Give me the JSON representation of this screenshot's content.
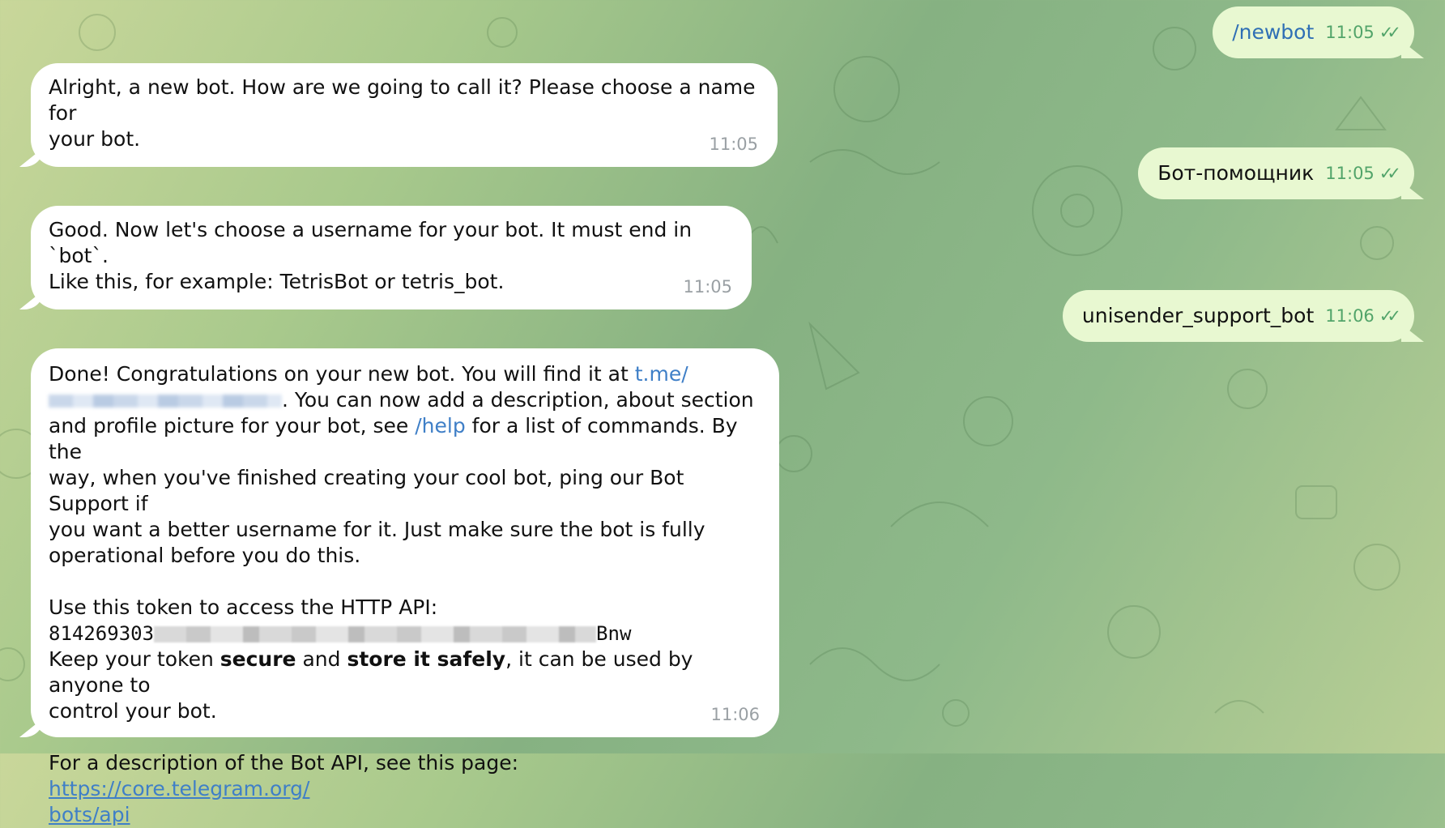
{
  "messages": {
    "out1": {
      "text": "/newbot",
      "time": "11:05"
    },
    "in1": {
      "line1": "Alright, a new bot. How are we going to call it? Please choose a name for",
      "line2": "your bot.",
      "time": "11:05"
    },
    "out2": {
      "text": "Бот-помощник",
      "time": "11:05"
    },
    "in2": {
      "line1": "Good. Now let's choose a username for your bot. It must end in `bot`.",
      "line2": "Like this, for example: TetrisBot or tetris_bot.",
      "time": "11:05"
    },
    "out3": {
      "text": "unisender_support_bot",
      "time": "11:06"
    },
    "in3": {
      "p1_a": "Done! Congratulations on your new bot. You will find it at ",
      "p1_link": "t.me/",
      "p1_b": ". You can now add a description, about section",
      "p1_c": "and profile picture for your bot, see ",
      "p1_help": "/help",
      "p1_d": " for a list of commands. By the",
      "p1_e": "way, when you've finished creating your cool bot, ping our Bot Support if",
      "p1_f": "you want a better username for it. Just make sure the bot is fully",
      "p1_g": "operational before you do this.",
      "p2_a": "Use this token to access the HTTP API:",
      "token_start": "814269303",
      "token_end": "Bnw",
      "p2_b1": "Keep your token ",
      "p2_secure": "secure",
      "p2_and": " and ",
      "p2_store": "store it safely",
      "p2_b2": ", it can be used by anyone to",
      "p2_c": "control your bot.",
      "p3_a": "For a description of the Bot API, see this page: ",
      "p3_link1": "https://core.telegram.org/",
      "p3_link2": "bots/api",
      "time": "11:06"
    }
  },
  "colors": {
    "outgoing_bubble": "#e8f8d1",
    "incoming_bubble": "#ffffff",
    "link": "#3f7fc7",
    "time_outgoing": "#52a46a"
  },
  "icons": {
    "read_receipt": "double-check-icon"
  }
}
